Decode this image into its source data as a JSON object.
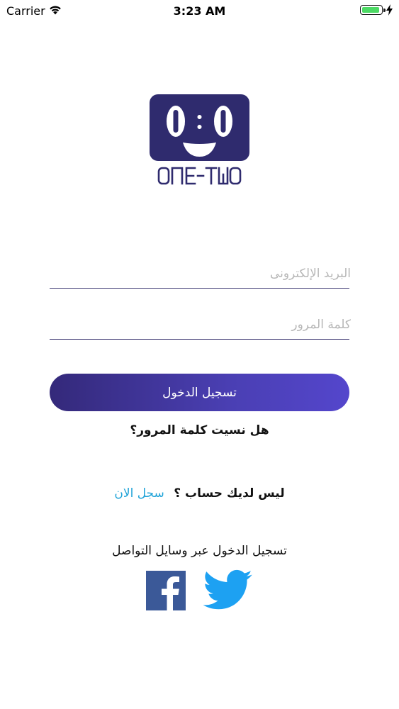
{
  "status_bar": {
    "carrier": "Carrier",
    "time": "3:23 AM"
  },
  "logo": {
    "text": "ONE-TWO"
  },
  "form": {
    "email_placeholder": "البريد الإلكترونى",
    "email_value": "",
    "password_placeholder": "كلمة المرور",
    "password_value": "",
    "login_label": "تسجيل الدخول",
    "forgot_label": "هل نسيت كلمة المرور؟"
  },
  "signup": {
    "question": "ليس لديك حساب ؟",
    "link": "سجل الان"
  },
  "social": {
    "title": "تسجيل الدخول عبر وسايل التواصل",
    "icons": [
      "facebook-icon",
      "twitter-icon"
    ]
  },
  "colors": {
    "brand": "#2f2b6e",
    "button_start": "#34297a",
    "button_end": "#5446cc",
    "link": "#1fa3d8",
    "twitter": "#1da1f2",
    "facebook": "#3b5998",
    "battery": "#4cd964"
  }
}
